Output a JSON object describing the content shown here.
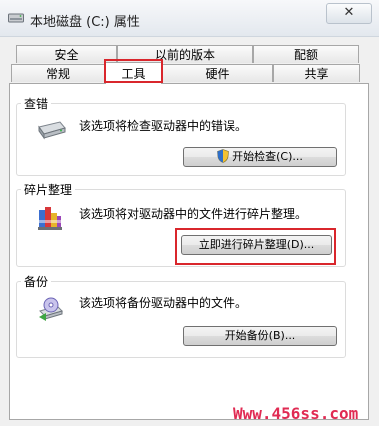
{
  "window": {
    "title": "本地磁盘 (C:) 属性",
    "close_label": "✕"
  },
  "tabs": {
    "row1": [
      "安全",
      "以前的版本",
      "配额"
    ],
    "row2": [
      "常规",
      "工具",
      "硬件",
      "共享"
    ],
    "active": "工具"
  },
  "sections": {
    "check": {
      "title": "查错",
      "description": "该选项将检查驱动器中的错误。",
      "button": "开始检查(C)...",
      "icon": "hard-drive-icon"
    },
    "defrag": {
      "title": "碎片整理",
      "description": "该选项将对驱动器中的文件进行碎片整理。",
      "button": "立即进行碎片整理(D)...",
      "icon": "defrag-icon"
    },
    "backup": {
      "title": "备份",
      "description": "该选项将备份驱动器中的文件。",
      "button": "开始备份(B)...",
      "icon": "backup-icon"
    }
  },
  "watermark": "Www.456ss.com",
  "colors": {
    "annotation_red": "#d9262c",
    "watermark": "#e02b53"
  }
}
